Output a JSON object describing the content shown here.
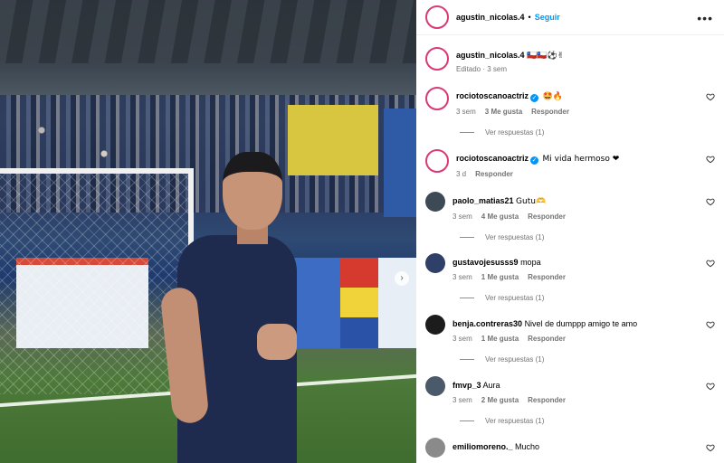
{
  "post": {
    "author": "agustin_nicolas.4",
    "bullet": "•",
    "follow_label": "Seguir",
    "more_icon": "more-horizontal-icon",
    "caption_text": "🇨🇱🇨🇱⚽✌",
    "caption_meta": "Editado · 3 sem"
  },
  "photo": {
    "next_icon": "chevron-right-icon",
    "next_glyph": "›"
  },
  "comments": [
    {
      "user": "rociotoscanoactriz",
      "verified": true,
      "text": "🤩🔥",
      "time": "3 sem",
      "likes": "3 Me gusta",
      "reply": "Responder",
      "replies": "Ver respuestas (1)",
      "avatar": "ring"
    },
    {
      "user": "rociotoscanoactriz",
      "verified": true,
      "text": "Mi vida hermoso ❤",
      "time": "3 d",
      "likes": "",
      "reply": "Responder",
      "replies": "",
      "avatar": "ring"
    },
    {
      "user": "paolo_matias21",
      "verified": false,
      "text": "Gutu🫶",
      "time": "3 sem",
      "likes": "4 Me gusta",
      "reply": "Responder",
      "replies": "Ver respuestas (1)",
      "avatar": "#3d4a56"
    },
    {
      "user": "gustavojesusss9",
      "verified": false,
      "text": "mopa",
      "time": "3 sem",
      "likes": "1 Me gusta",
      "reply": "Responder",
      "replies": "Ver respuestas (1)",
      "avatar": "#2e3f68"
    },
    {
      "user": "benja.contreras30",
      "verified": false,
      "text": "Nivel de dumppp amigo te amo",
      "time": "3 sem",
      "likes": "1 Me gusta",
      "reply": "Responder",
      "replies": "Ver respuestas (1)",
      "avatar": "#1c1c1c"
    },
    {
      "user": "fmvp_3",
      "verified": false,
      "text": "Aura",
      "time": "3 sem",
      "likes": "2 Me gusta",
      "reply": "Responder",
      "replies": "Ver respuestas (1)",
      "avatar": "#4a5a6a"
    },
    {
      "user": "emiliomoreno._",
      "verified": false,
      "text": "Mucho",
      "time": "",
      "likes": "",
      "reply": "",
      "replies": "",
      "avatar": "#8a8a8a"
    }
  ]
}
